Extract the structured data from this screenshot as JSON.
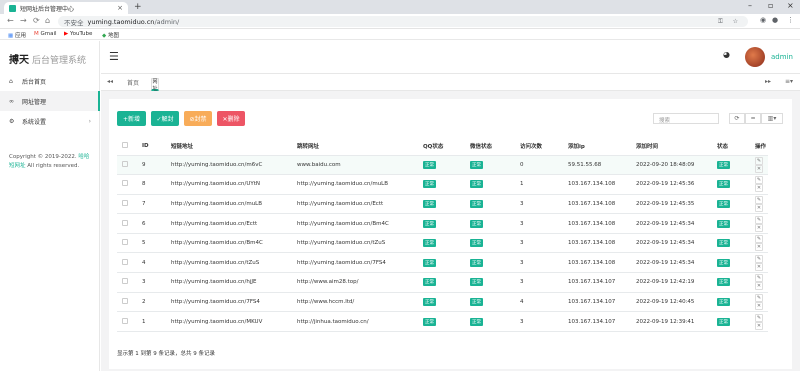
{
  "browser": {
    "tab_title": "短网址后台管理中心",
    "address_insecure": "不安全",
    "address_host": "yuming.taomiduo.cn",
    "address_path": "/admin/",
    "bookmarks": [
      "应用",
      "Gmail",
      "YouTube",
      "地图"
    ]
  },
  "sidebar": {
    "brand": "搏天",
    "brand_sub": "后台管理系统",
    "items": [
      {
        "label": "后台首页",
        "icon": "home-icon"
      },
      {
        "label": "网址管理",
        "icon": "link-icon"
      },
      {
        "label": "系统设置",
        "icon": "gear-icon"
      }
    ],
    "copyright_prefix": "Copyright © 2019-2022.",
    "copyright_link": "短网址",
    "copyright_link_prefix": "哈哈",
    "copyright_suffix": "All rights reserved."
  },
  "header": {
    "user": "admin"
  },
  "tabs": {
    "home": "首页",
    "current": "网址管理"
  },
  "toolbar": {
    "add": "+新增",
    "enable": "✓解封",
    "ban": "⊘封禁",
    "delete": "✕删除",
    "search_placeholder": "搜索"
  },
  "table": {
    "headers": [
      "ID",
      "短链地址",
      "跳转网址",
      "QQ状态",
      "微信状态",
      "访问次数",
      "添加ip",
      "添加时间",
      "状态",
      "操作"
    ],
    "rows": [
      {
        "id": "9",
        "short": "http://yuming.taomiduo.cn/m6vC",
        "target": "www.baidu.com",
        "qq": "正常",
        "wx": "正常",
        "visits": "0",
        "ip": "59.51.55.68",
        "time": "2022-09-20 18:48:09",
        "status": "正常"
      },
      {
        "id": "8",
        "short": "http://yuming.taomiduo.cn/UYtN",
        "target": "http://yuming.taomiduo.cn/muLB",
        "qq": "正常",
        "wx": "正常",
        "visits": "1",
        "ip": "103.167.134.108",
        "time": "2022-09-19 12:45:36",
        "status": "正常"
      },
      {
        "id": "7",
        "short": "http://yuming.taomiduo.cn/muLB",
        "target": "http://yuming.taomiduo.cn/Ectt",
        "qq": "正常",
        "wx": "正常",
        "visits": "3",
        "ip": "103.167.134.108",
        "time": "2022-09-19 12:45:35",
        "status": "正常"
      },
      {
        "id": "6",
        "short": "http://yuming.taomiduo.cn/Ectt",
        "target": "http://yuming.taomiduo.cn/Bm4C",
        "qq": "正常",
        "wx": "正常",
        "visits": "3",
        "ip": "103.167.134.108",
        "time": "2022-09-19 12:45:34",
        "status": "正常"
      },
      {
        "id": "5",
        "short": "http://yuming.taomiduo.cn/Bm4C",
        "target": "http://yuming.taomiduo.cn/tZuS",
        "qq": "正常",
        "wx": "正常",
        "visits": "3",
        "ip": "103.167.134.108",
        "time": "2022-09-19 12:45:34",
        "status": "正常"
      },
      {
        "id": "4",
        "short": "http://yuming.taomiduo.cn/tZuS",
        "target": "http://yuming.taomiduo.cn/7FS4",
        "qq": "正常",
        "wx": "正常",
        "visits": "3",
        "ip": "103.167.134.108",
        "time": "2022-09-19 12:45:34",
        "status": "正常"
      },
      {
        "id": "3",
        "short": "http://yuming.taomiduo.cn/hjJE",
        "target": "http://www.aim28.top/",
        "qq": "正常",
        "wx": "正常",
        "visits": "3",
        "ip": "103.167.134.107",
        "time": "2022-09-19 12:42:19",
        "status": "正常"
      },
      {
        "id": "2",
        "short": "http://yuming.taomiduo.cn/7FS4",
        "target": "http://www.hccm.ltd/",
        "qq": "正常",
        "wx": "正常",
        "visits": "4",
        "ip": "103.167.134.107",
        "time": "2022-09-19 12:40:45",
        "status": "正常"
      },
      {
        "id": "1",
        "short": "http://yuming.taomiduo.cn/MKUV",
        "target": "http://jinhua.taomiduo.cn/",
        "qq": "正常",
        "wx": "正常",
        "visits": "3",
        "ip": "103.167.134.107",
        "time": "2022-09-19 12:39:41",
        "status": "正常"
      }
    ],
    "footer": "显示第 1 到第 9 条记录，总共 9 条记录"
  },
  "colors": {
    "accent": "#1ab394",
    "enable": "#1ab394",
    "ban": "#f8ac59",
    "delete": "#ed5565"
  }
}
